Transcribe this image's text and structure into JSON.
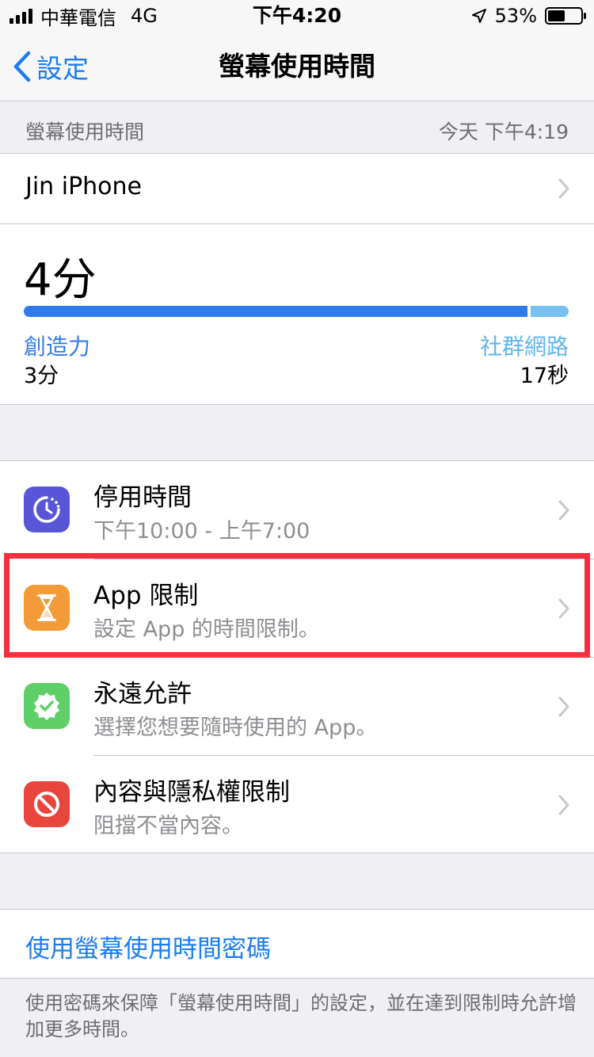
{
  "status_bar": {
    "carrier": "中華電信",
    "network": "4G",
    "time": "下午4:20",
    "battery": "53%",
    "battery_level": 0.53
  },
  "nav": {
    "back_label": "設定",
    "title": "螢幕使用時間"
  },
  "summary": {
    "header_label": "螢幕使用時間",
    "header_time": "今天 下午4:19",
    "device_name": "Jin iPhone",
    "total": "4分",
    "categories": [
      {
        "name": "創造力",
        "value": "3分",
        "color": "#2f7bea"
      },
      {
        "name": "社群網路",
        "value": "17秒",
        "color": "#77c0f2"
      }
    ]
  },
  "options": [
    {
      "title": "停用時間",
      "subtitle": "下午10:00 - 上午7:00",
      "icon": "downtime-icon",
      "color": "#5856d6"
    },
    {
      "title": "App 限制",
      "subtitle": "設定 App 的時間限制。",
      "icon": "hourglass-icon",
      "color": "#f29b38"
    },
    {
      "title": "永遠允許",
      "subtitle": "選擇您想要隨時使用的 App。",
      "icon": "checkmark-badge-icon",
      "color": "#5fcf68"
    },
    {
      "title": "內容與隱私權限制",
      "subtitle": "阻擋不當內容。",
      "icon": "restriction-icon",
      "color": "#e8453c"
    }
  ],
  "passcode": {
    "label": "使用螢幕使用時間密碼",
    "footer": "使用密碼來保障「螢幕使用時間」的設定，並在達到限制時允許增加更多時間。"
  }
}
